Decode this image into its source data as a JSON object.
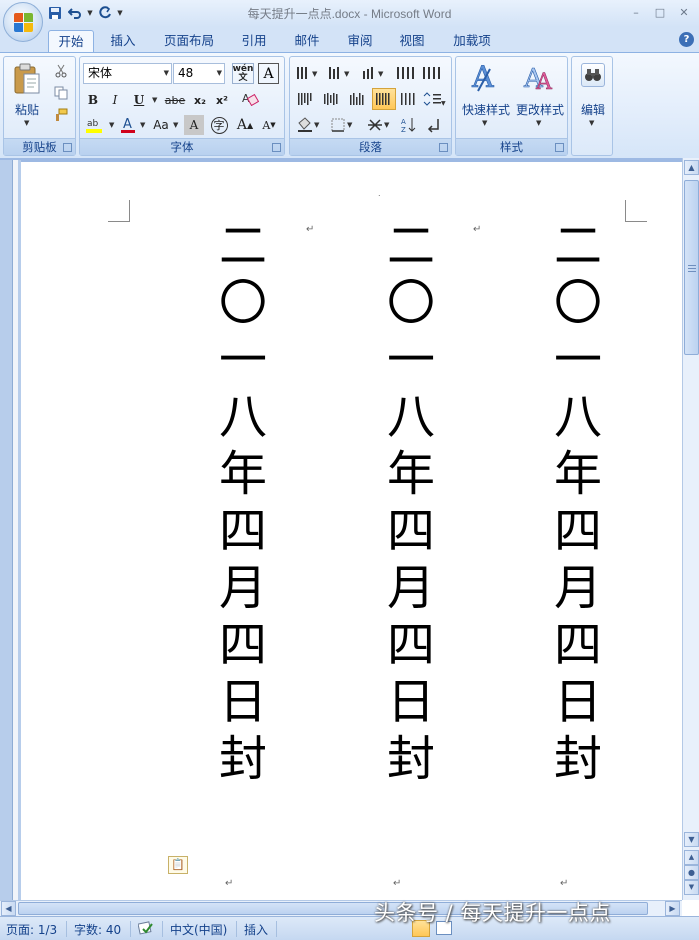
{
  "app": {
    "title": "每天提升一点点.docx - Microsoft Word"
  },
  "window_controls": [
    "–",
    "□",
    "✕"
  ],
  "tabs": [
    {
      "label": "开始",
      "active": true
    },
    {
      "label": "插入"
    },
    {
      "label": "页面布局"
    },
    {
      "label": "引用"
    },
    {
      "label": "邮件"
    },
    {
      "label": "审阅"
    },
    {
      "label": "视图"
    },
    {
      "label": "加载项"
    }
  ],
  "ribbon": {
    "clipboard": {
      "label": "剪贴板",
      "paste_label": "粘贴"
    },
    "font": {
      "label": "字体",
      "font_name": "宋体",
      "font_size": "48",
      "wen_label": "wén\n文",
      "bold": "B",
      "italic": "I",
      "underline": "U",
      "strike": "abe",
      "subscript": "x₂",
      "superscript": "x²",
      "case": "Aa",
      "char_shade": "A",
      "enclose": "字",
      "grow": "A",
      "shrink": "A"
    },
    "paragraph": {
      "label": "段落"
    },
    "styles": {
      "label": "样式",
      "quick_styles": "快速样式",
      "change_styles": "更改样式"
    },
    "editing": {
      "label": "编辑"
    }
  },
  "document": {
    "columns": [
      [
        "二",
        "〇",
        "一",
        "八",
        "年",
        "四",
        "月",
        "四",
        "日",
        "封"
      ],
      [
        "二",
        "〇",
        "一",
        "八",
        "年",
        "四",
        "月",
        "四",
        "日",
        "封"
      ],
      [
        "二",
        "〇",
        "一",
        "八",
        "年",
        "四",
        "月",
        "四",
        "日",
        "封"
      ]
    ],
    "paragraph_mark": "↵"
  },
  "status": {
    "page": "页面: 1/3",
    "word_count": "字数: 40",
    "language": "中文(中国)",
    "mode": "插入"
  },
  "watermark": "头条号 / 每天提升一点点",
  "colors": {
    "accent": "#15428b",
    "ribbon_bg": "#dce9f9",
    "doc_bg": "#9db9e3"
  }
}
